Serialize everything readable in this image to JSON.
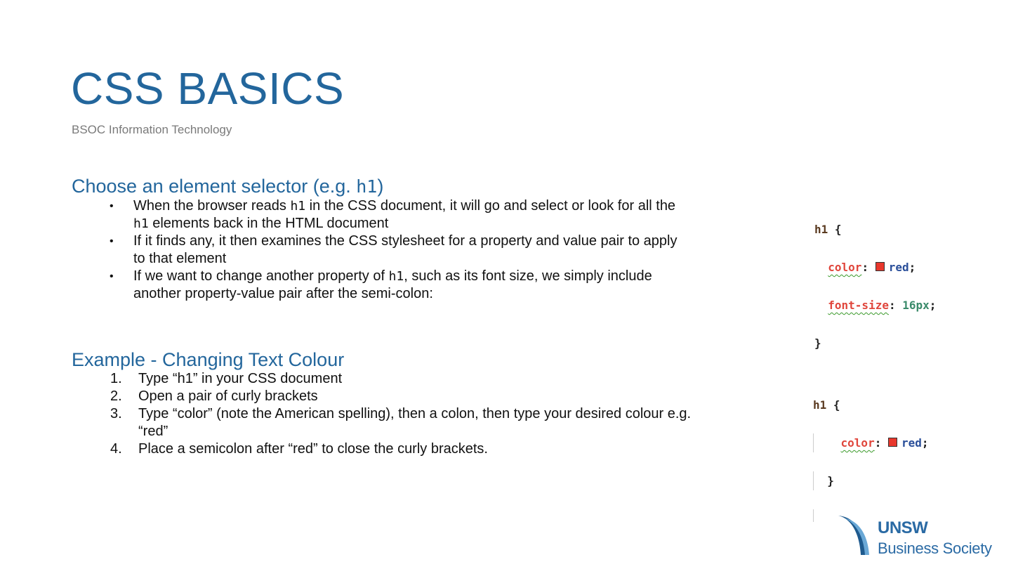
{
  "title": "CSS BASICS",
  "subtitle": "BSOC Information Technology",
  "section1": {
    "heading_pre": "Choose an element selector (e.g. ",
    "heading_code": "h1",
    "heading_post": ")",
    "bullets": [
      {
        "pre": "When the browser reads ",
        "code": "h1",
        "post": " in the CSS document, it will go and select or look for all the",
        "line2_code": "h1",
        "line2_post": " elements back in the HTML document"
      },
      {
        "line1": "If it finds any, it then examines the CSS stylesheet for a property and value pair to apply",
        "line2": "to that element"
      },
      {
        "pre": "If we want to change another property of ",
        "code": "h1",
        "post": ", such as its font size, we simply include",
        "line2": "another property-value pair after the semi-colon:"
      }
    ]
  },
  "section2": {
    "heading": "Example - Changing Text Colour",
    "steps": [
      {
        "num": "1.",
        "line1": "Type “h1” in your CSS document"
      },
      {
        "num": "2.",
        "line1": "Open a pair of curly brackets"
      },
      {
        "num": "3.",
        "line1": "Type “color” (note the American spelling), then a colon, then type your desired colour e.g.",
        "line2": "“red”"
      },
      {
        "num": "4.",
        "line1": "Place a semicolon after “red” to close the curly brackets."
      }
    ]
  },
  "code1": {
    "selector": "h1",
    "open": "{",
    "prop1": "color",
    "val1": "red",
    "prop2": "font-size",
    "val2": "16px",
    "close": "}"
  },
  "code2": {
    "selector": "h1",
    "open": "{",
    "prop1": "color",
    "val1": "red",
    "close": "}"
  },
  "logo": {
    "line1": "UNSW",
    "line2": "Business Society"
  },
  "colors": {
    "accent": "#23669c",
    "swatch_red": "#e8372c"
  }
}
